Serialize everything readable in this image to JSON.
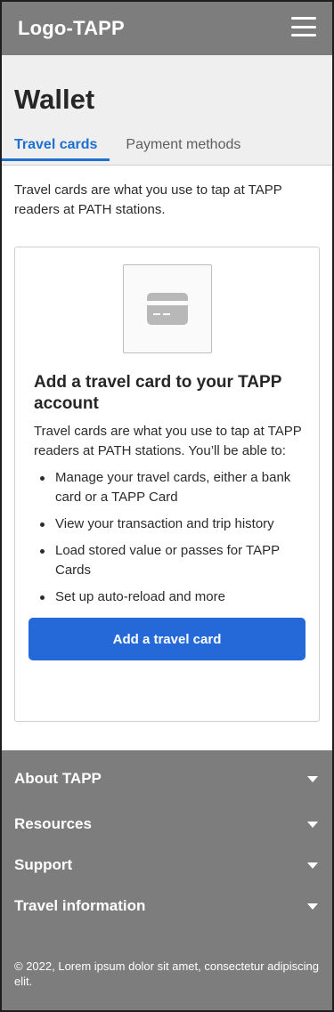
{
  "header": {
    "logo": "Logo-TAPP"
  },
  "page": {
    "title": "Wallet",
    "tabs": [
      {
        "label": "Travel cards"
      },
      {
        "label": "Payment methods"
      }
    ],
    "intro": "Travel cards are what you use to tap at TAPP readers at PATH stations."
  },
  "panel": {
    "heading": "Add a travel card to your TAPP account",
    "body": "Travel cards are what you use to tap at TAPP readers at PATH stations. You’ll be able to:",
    "bullets": [
      "Manage your travel cards, either a bank card or a TAPP Card",
      "View your transaction and trip history",
      "Load stored value or passes for TAPP Cards",
      "Set up auto-reload and more"
    ],
    "cta_label": "Add a travel card"
  },
  "footer": {
    "items": [
      {
        "label": "About TAPP"
      },
      {
        "label": "Resources"
      },
      {
        "label": "Support"
      },
      {
        "label": "Travel information"
      }
    ],
    "copyright": "© 2022, Lorem ipsum dolor sit amet, consectetur adipiscing elit."
  },
  "colors": {
    "accent": "#2569d9",
    "tab_active": "#1f6fd1",
    "header_footer": "#7d7d7d"
  },
  "icons": {
    "menu": "hamburger-menu-icon",
    "card": "credit-card-icon",
    "caret": "chevron-down-icon"
  }
}
